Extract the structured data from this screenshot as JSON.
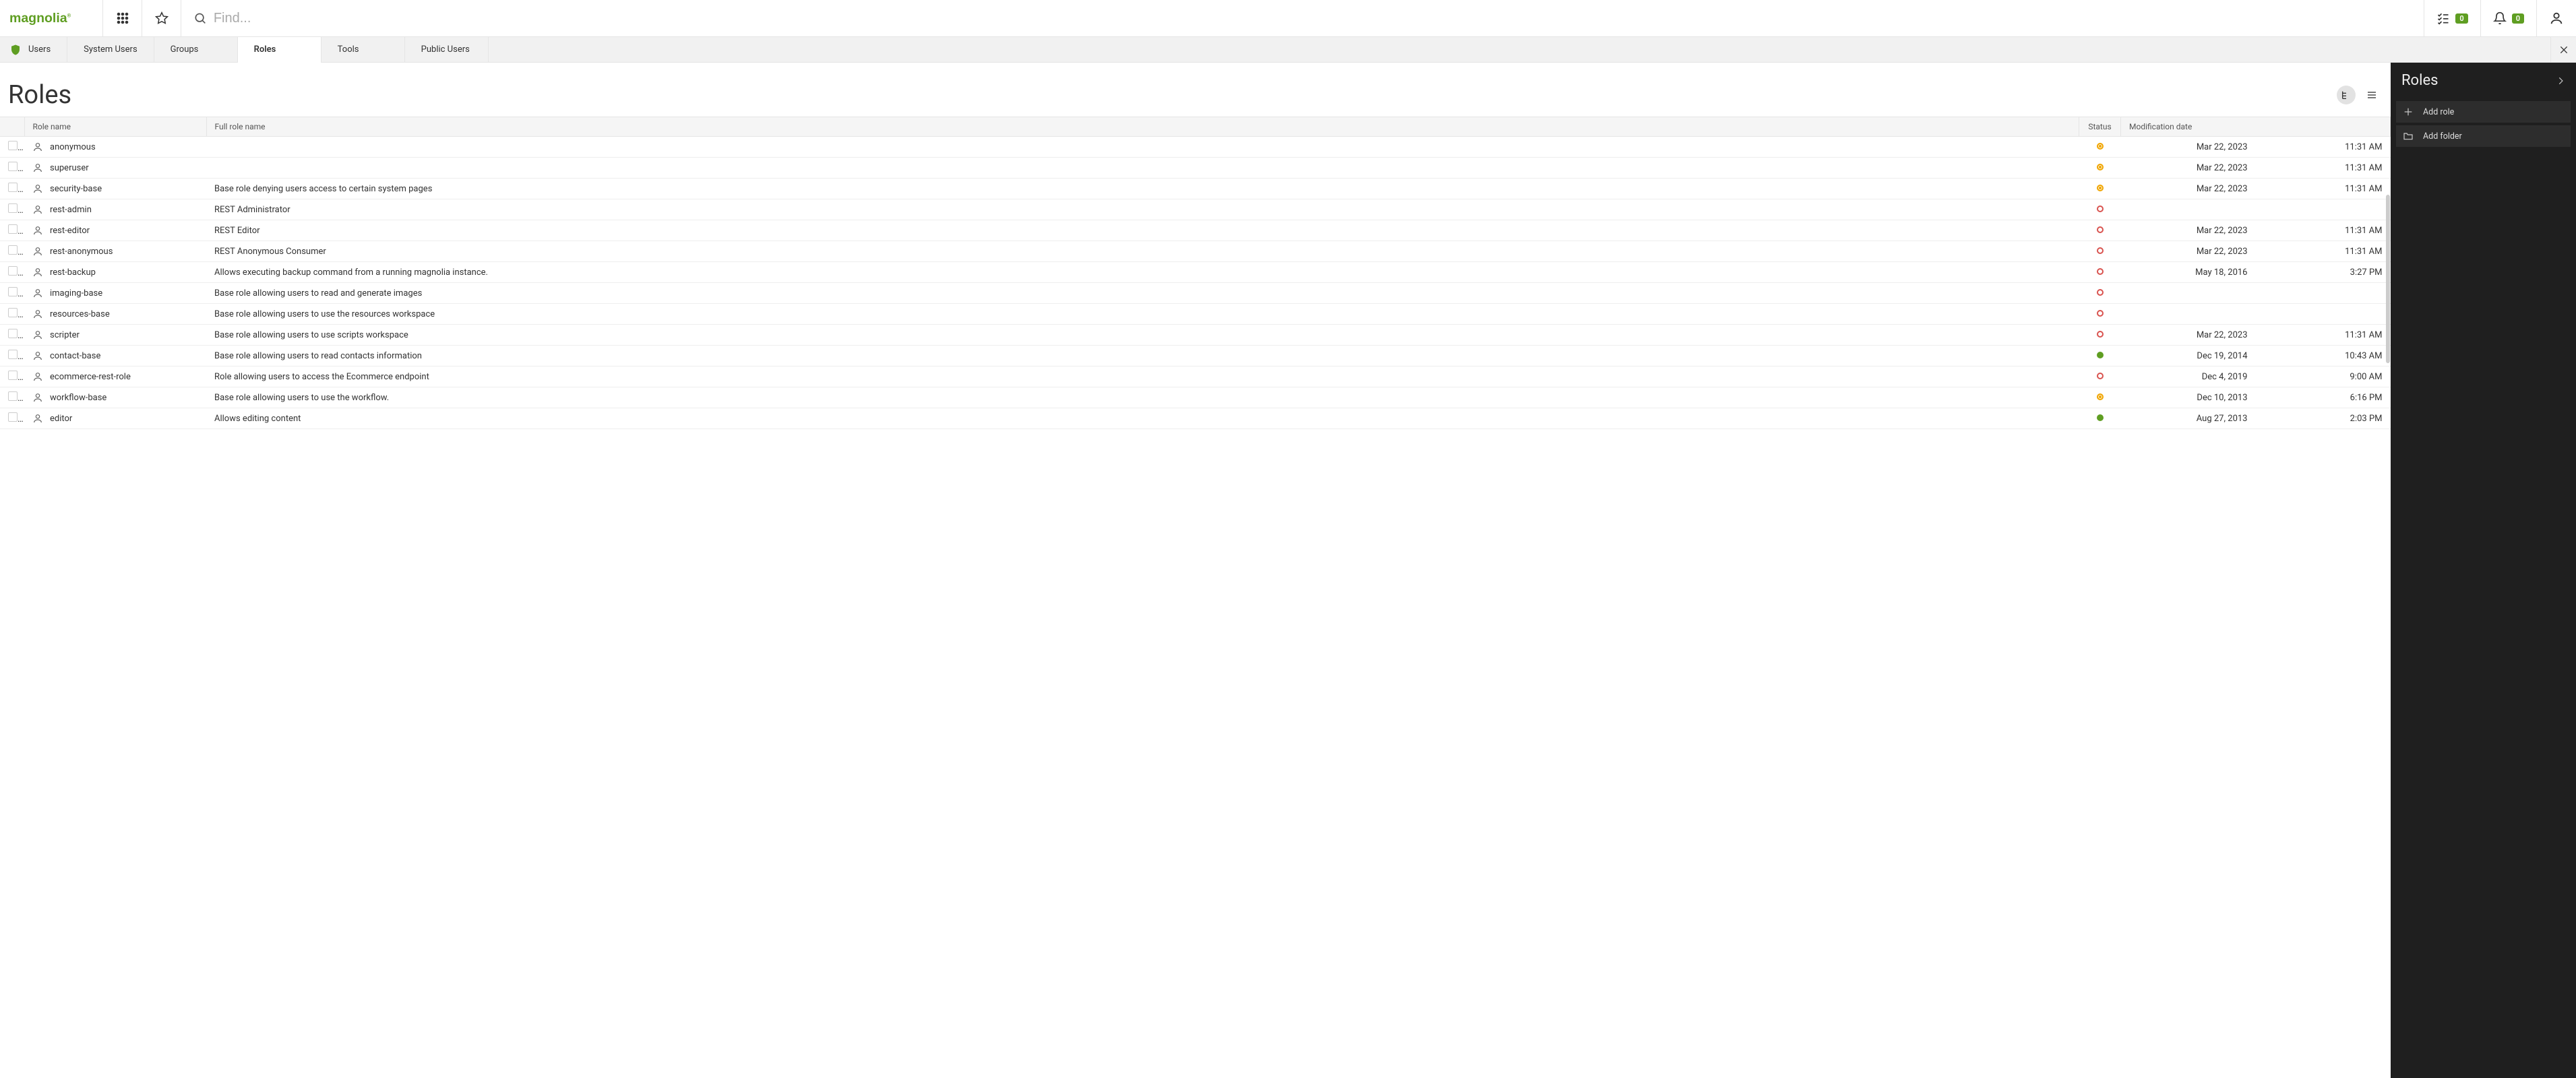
{
  "header": {
    "search_placeholder": "Find...",
    "tasks_count": "0",
    "notifications_count": "0"
  },
  "subnav": {
    "app_label": "Users",
    "tabs": [
      "System Users",
      "Groups",
      "Roles",
      "Tools",
      "Public Users"
    ],
    "active_index": 2
  },
  "page": {
    "title": "Roles"
  },
  "columns": {
    "name": "Role name",
    "full": "Full role name",
    "status": "Status",
    "date": "Modification date"
  },
  "rows": [
    {
      "name": "anonymous",
      "full": "",
      "status": "modified",
      "date": "Mar 22, 2023",
      "time": "11:31 AM"
    },
    {
      "name": "superuser",
      "full": "",
      "status": "modified",
      "date": "Mar 22, 2023",
      "time": "11:31 AM"
    },
    {
      "name": "security-base",
      "full": "Base role denying users access to certain system pages",
      "status": "modified",
      "date": "Mar 22, 2023",
      "time": "11:31 AM"
    },
    {
      "name": "rest-admin",
      "full": "REST Administrator",
      "status": "unpublished",
      "date": "",
      "time": ""
    },
    {
      "name": "rest-editor",
      "full": "REST Editor",
      "status": "unpublished",
      "date": "Mar 22, 2023",
      "time": "11:31 AM"
    },
    {
      "name": "rest-anonymous",
      "full": "REST Anonymous Consumer",
      "status": "unpublished",
      "date": "Mar 22, 2023",
      "time": "11:31 AM"
    },
    {
      "name": "rest-backup",
      "full": "Allows executing backup command from a running magnolia instance.",
      "status": "unpublished",
      "date": "May 18, 2016",
      "time": "3:27 PM"
    },
    {
      "name": "imaging-base",
      "full": "Base role allowing users to read and generate images",
      "status": "unpublished",
      "date": "",
      "time": ""
    },
    {
      "name": "resources-base",
      "full": "Base role allowing users to use the resources workspace",
      "status": "unpublished",
      "date": "",
      "time": ""
    },
    {
      "name": "scripter",
      "full": "Base role allowing users to use scripts workspace",
      "status": "unpublished",
      "date": "Mar 22, 2023",
      "time": "11:31 AM"
    },
    {
      "name": "contact-base",
      "full": "Base role allowing users to read contacts information",
      "status": "published",
      "date": "Dec 19, 2014",
      "time": "10:43 AM"
    },
    {
      "name": "ecommerce-rest-role",
      "full": "Role allowing users to access the Ecommerce endpoint",
      "status": "unpublished",
      "date": "Dec 4, 2019",
      "time": "9:00 AM"
    },
    {
      "name": "workflow-base",
      "full": "Base role allowing users to use the workflow.",
      "status": "modified",
      "date": "Dec 10, 2013",
      "time": "6:16 PM"
    },
    {
      "name": "editor",
      "full": "Allows editing content",
      "status": "published",
      "date": "Aug 27, 2013",
      "time": "2:03 PM"
    }
  ],
  "side": {
    "title": "Roles",
    "actions": [
      {
        "icon": "plus",
        "label": "Add role"
      },
      {
        "icon": "folder",
        "label": "Add folder"
      }
    ]
  }
}
